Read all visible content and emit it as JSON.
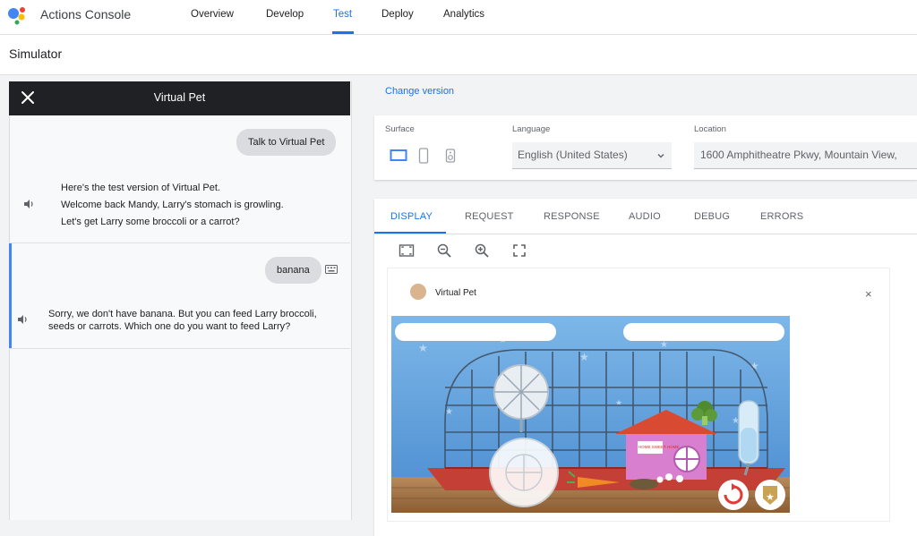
{
  "app": {
    "title": "Actions Console"
  },
  "nav": [
    "Overview",
    "Develop",
    "Test",
    "Deploy",
    "Analytics"
  ],
  "page": {
    "title": "Simulator"
  },
  "chat": {
    "title": "Virtual Pet",
    "messages": [
      {
        "user": "Talk to Virtual Pet"
      },
      {
        "bot": [
          "Here's the test version of Virtual Pet.",
          "Welcome back Mandy, Larry's stomach is growling.",
          "Let's get Larry some broccoli or a carrot?"
        ]
      },
      {
        "user": "banana"
      },
      {
        "bot": [
          "Sorry, we don't have banana. But you can feed Larry broccoli,",
          "seeds or carrots. Which one do you want to feed Larry?"
        ]
      }
    ]
  },
  "settings": {
    "change_version": "Change version",
    "surface_label": "Surface",
    "language_label": "Language",
    "language_value": "English (United States)",
    "location_label": "Location",
    "location_value": "1600 Amphitheatre Pkwy, Mountain View,"
  },
  "tabs": [
    "DISPLAY",
    "REQUEST",
    "RESPONSE",
    "AUDIO",
    "DEBUG",
    "ERRORS"
  ],
  "display": {
    "app_name": "Virtual Pet",
    "close": "×",
    "sign": "HOME SWEET HOME"
  },
  "colors": {
    "accent": "#1a73e8",
    "chat_header": "#202124",
    "selected_bar": "#4285f4"
  }
}
